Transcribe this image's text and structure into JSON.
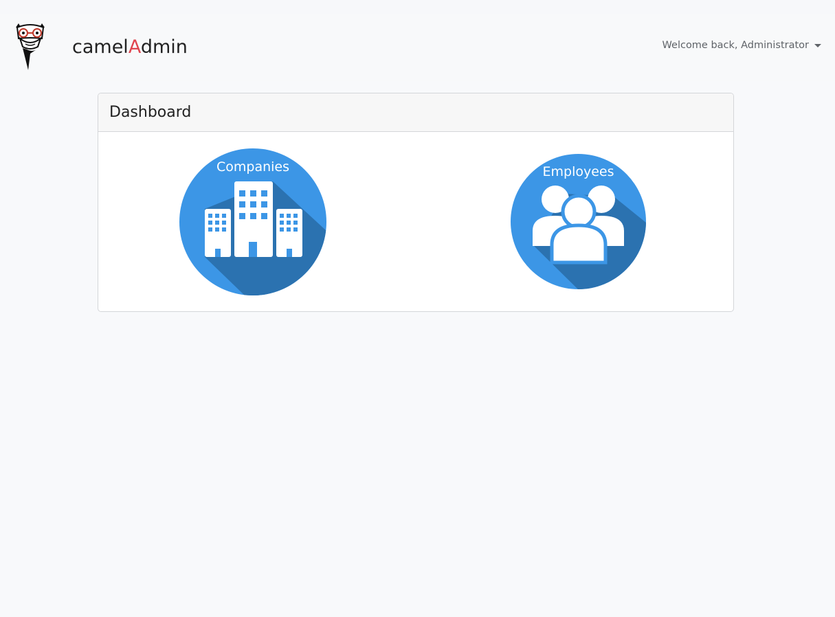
{
  "app": {
    "brand_prefix": "camel",
    "brand_accent": "A",
    "brand_suffix": "dmin",
    "logo_icon": "camel-logo-icon",
    "accent_color": "#e0454f"
  },
  "user_menu": {
    "label": "Welcome back, Administrator"
  },
  "dashboard": {
    "title": "Dashboard",
    "tiles": [
      {
        "label": "Companies",
        "icon": "buildings-icon",
        "color": "#3c96e6"
      },
      {
        "label": "Employees",
        "icon": "people-icon",
        "color": "#3c96e6"
      }
    ]
  }
}
